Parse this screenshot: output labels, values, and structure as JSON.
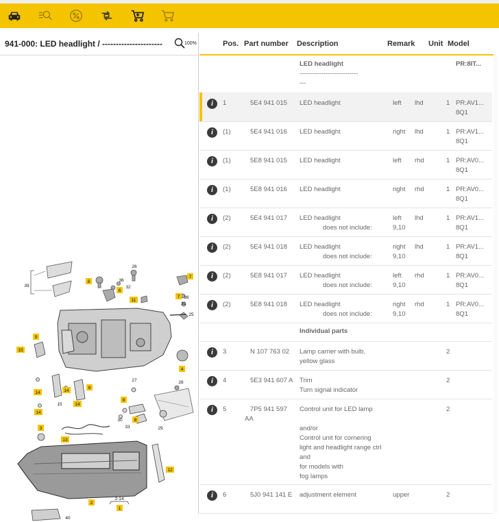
{
  "toolbar": {
    "icons": [
      "car-icon",
      "list-search-icon",
      "percent-icon",
      "exchange-icon",
      "cart-add-icon",
      "cart-icon"
    ]
  },
  "left": {
    "title": "941-000: LED headlight / ----------------------",
    "zoom": "100%"
  },
  "table": {
    "headers": {
      "pos": "Pos.",
      "part": "Part number",
      "desc": "Description",
      "remark": "Remark",
      "unit": "Unit",
      "model": "Model"
    },
    "group_header": {
      "desc1": "LED headlight",
      "desc2": "---------------------------",
      "desc3": "---",
      "model": "PR:8IT..."
    },
    "rows": [
      {
        "pos": "1",
        "part": "5E4 941 015",
        "desc": "LED headlight",
        "side": "left",
        "drive": "lhd",
        "unit": "1",
        "model": "PR:AV1...",
        "model2": "8Q1"
      },
      {
        "pos": "(1)",
        "part": "5E4 941 016",
        "desc": "LED headlight",
        "side": "right",
        "drive": "lhd",
        "unit": "1",
        "model": "PR:AV1...",
        "model2": "8Q1"
      },
      {
        "pos": "(1)",
        "part": "5E8 941 015",
        "desc": "LED headlight",
        "side": "left",
        "drive": "rhd",
        "unit": "1",
        "model": "PR:AV0...",
        "model2": "8Q1"
      },
      {
        "pos": "(1)",
        "part": "5E8 941 016",
        "desc": "LED headlight",
        "side": "right",
        "drive": "rhd",
        "unit": "1",
        "model": "PR:AV0...",
        "model2": "8Q1"
      },
      {
        "pos": "(2)",
        "part": "5E4 941 017",
        "desc": "LED headlight",
        "note": "does not include:",
        "side": "left",
        "drive": "lhd",
        "extra": "9,10",
        "unit": "1",
        "model": "PR:AV1...",
        "model2": "8Q1"
      },
      {
        "pos": "(2)",
        "part": "5E4 941 018",
        "desc": "LED headlight",
        "note": "does not include:",
        "side": "right",
        "drive": "lhd",
        "extra": "9,10",
        "unit": "1",
        "model": "PR:AV1...",
        "model2": "8Q1"
      },
      {
        "pos": "(2)",
        "part": "5E8 941 017",
        "desc": "LED headlight",
        "note": "does not include:",
        "side": "left",
        "drive": "rhd",
        "extra": "9,10",
        "unit": "1",
        "model": "PR:AV0...",
        "model2": "8Q1"
      },
      {
        "pos": "(2)",
        "part": "5E8 941 018",
        "desc": "LED headlight",
        "note": "does not include:",
        "side": "right",
        "drive": "rhd",
        "extra": "9,10",
        "unit": "1",
        "model": "PR:AV0...",
        "model2": "8Q1"
      }
    ],
    "section": "Individual parts",
    "parts": [
      {
        "pos": "3",
        "part": "N  107 763 02",
        "desc": [
          "Lamp carrier with bulb,",
          "yellow glass"
        ],
        "unit": "2"
      },
      {
        "pos": "4",
        "part": "5E3 941 607 A",
        "desc": [
          "Trim",
          "Turn signal indicator"
        ],
        "unit": "2"
      },
      {
        "pos": "5",
        "part": "7P5 941 597",
        "part2": "AA",
        "desc": [
          "Control unit for LED lamp",
          "",
          "and/or",
          "Control unit for cornering",
          "light and headlight range ctrl",
          "and",
          "for models with",
          "fog lamps"
        ],
        "unit": "2"
      },
      {
        "pos": "6",
        "part": "5J0 941 141 E",
        "desc": [
          "adjustment element"
        ],
        "remark": "upper",
        "unit": "2"
      }
    ]
  },
  "diagram_labels": [
    "39",
    "8",
    "36",
    "32",
    "6",
    "26",
    "7",
    "7",
    "36",
    "31",
    "11",
    "25",
    "9",
    "15",
    "4",
    "14",
    "14",
    "15",
    "14",
    "6",
    "14",
    "27",
    "28",
    "8",
    "30",
    "33",
    "8",
    "29",
    "3",
    "13",
    "12",
    "2",
    "2-14",
    "1",
    "40"
  ],
  "colors": {
    "accent": "#f5c400",
    "info": "#3a3a3a",
    "selected_row": "#f2f2f2"
  }
}
